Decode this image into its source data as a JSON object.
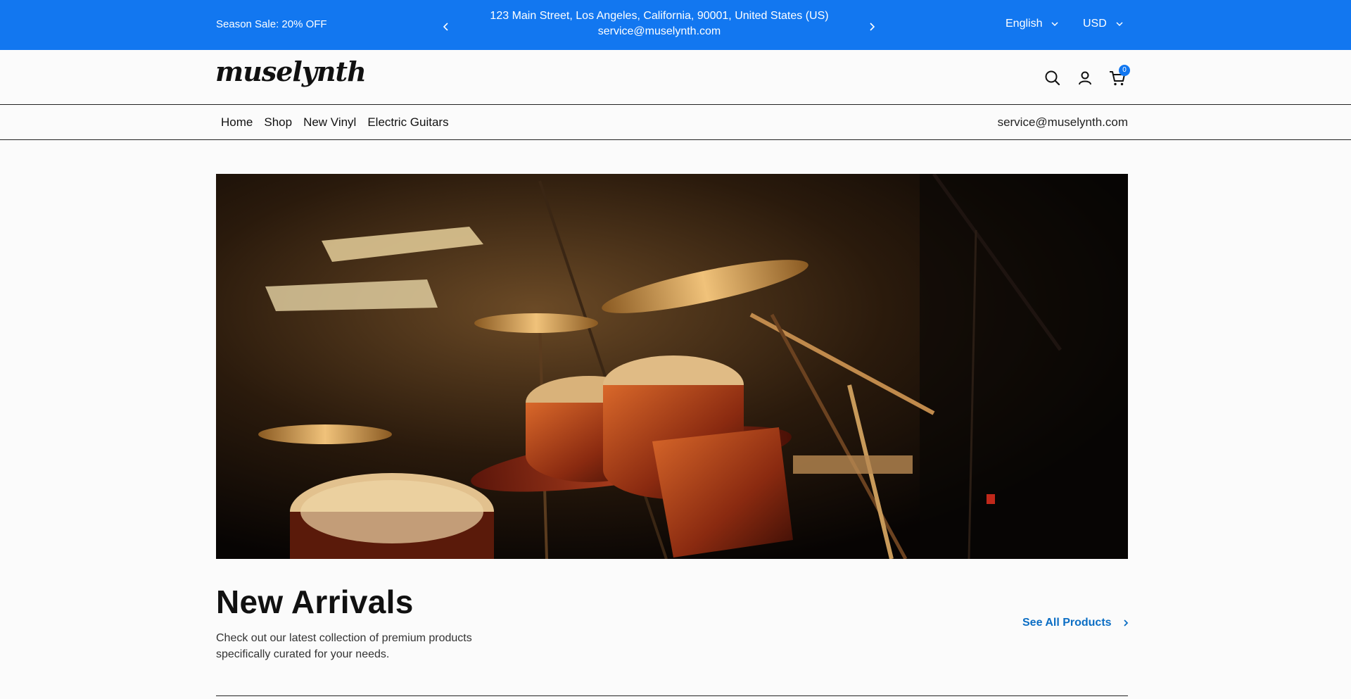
{
  "topbar": {
    "promo": "Season Sale: 20% OFF",
    "address_line1": "123 Main Street, Los Angeles, California, 90001, United States (US)",
    "address_line2": "service@muselynth.com",
    "language": "English",
    "currency": "USD",
    "background": "#1277f0"
  },
  "header": {
    "logo": "muselynth",
    "icons": [
      "search-icon",
      "user-icon",
      "cart-icon"
    ],
    "cart_count": "0"
  },
  "nav": {
    "items": [
      {
        "label": "Home"
      },
      {
        "label": "Shop"
      },
      {
        "label": "New Vinyl"
      },
      {
        "label": "Electric Guitars"
      }
    ],
    "email": "service@muselynth.com"
  },
  "new_arrivals": {
    "title": "New Arrivals",
    "subtitle": "Check out our latest collection of premium products specifically curated for your needs.",
    "see_all": "See All Products",
    "link_color": "#0c6ec4"
  }
}
